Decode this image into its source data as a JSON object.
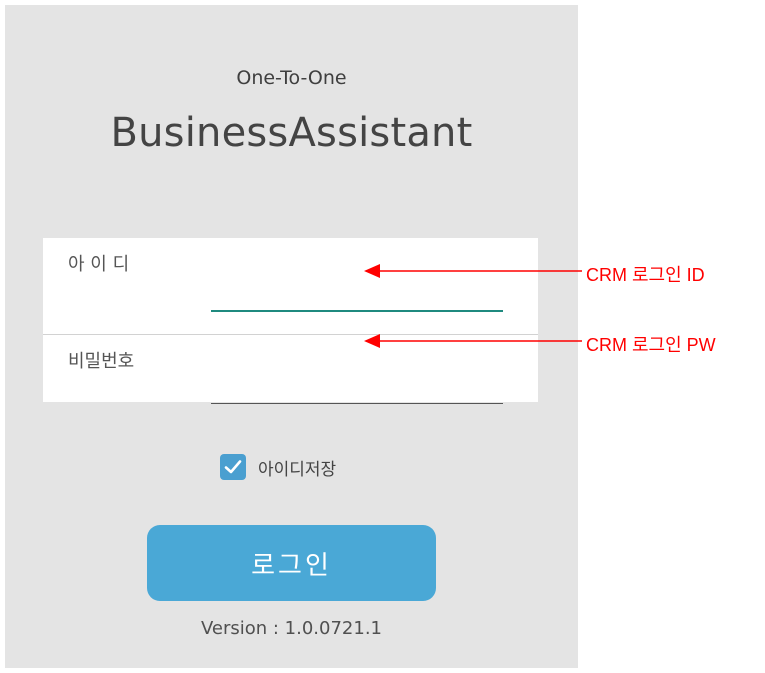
{
  "app": {
    "subtitle": "One-To-One",
    "title": "BusinessAssistant"
  },
  "form": {
    "id_label": "아 이 디",
    "id_value": "",
    "password_label": "비밀번호",
    "password_value": "",
    "remember_id_label": "아이디저장",
    "remember_id_checked": true
  },
  "login_button_label": "로그인",
  "version_text": "Version : 1.0.0721.1",
  "annotations": {
    "id_callout": "CRM 로그인 ID",
    "pw_callout": "CRM 로그인 PW",
    "color": "#ff0000"
  },
  "colors": {
    "background": "#e4e4e4",
    "accent_blue": "#4aa8d6",
    "focus_underline": "#1f8a7f"
  },
  "icons": {
    "checkbox": "check-icon"
  }
}
